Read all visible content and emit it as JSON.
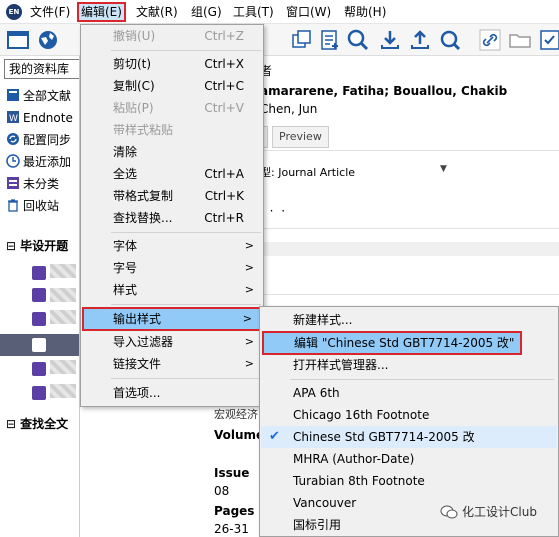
{
  "menubar": {
    "app_logo": "EN",
    "items": [
      "文件(F)",
      "编辑(E)",
      "文献(R)",
      "组(G)",
      "工具(T)",
      "窗口(W)",
      "帮助(H)"
    ]
  },
  "sidebar": {
    "library": "我的资料库",
    "items": [
      "全部文献",
      "Endnote",
      "配置同步",
      "最近添加",
      "未分类",
      "回收站"
    ],
    "group_title": "毕设开题",
    "find_full_text": "查找全文"
  },
  "main": {
    "authors_heading": "者",
    "authors_line1": "amararene, Fatiha; Bouallou, Chakib",
    "authors_line2": "Chen, Jun",
    "tab_preview": "Preview",
    "ref_type_label": "型:",
    "ref_type_value": "Journal Article",
    "ellipsis": "· · ·",
    "fragment": "宏观经济",
    "volume_label": "Volume",
    "issue_label": "Issue",
    "issue_value": "08",
    "pages_label": "Pages",
    "pages_value": "26-31"
  },
  "edit_menu": {
    "items": [
      {
        "label": "撤销(U)",
        "shortcut": "Ctrl+Z",
        "disabled": true
      },
      {
        "label": "剪切(t)",
        "shortcut": "Ctrl+X",
        "disabled": false
      },
      {
        "label": "复制(C)",
        "shortcut": "Ctrl+C",
        "disabled": false
      },
      {
        "label": "粘贴(P)",
        "shortcut": "Ctrl+V",
        "disabled": true
      },
      {
        "label": "带样式粘贴",
        "shortcut": "",
        "disabled": true
      },
      {
        "label": "清除",
        "shortcut": "",
        "disabled": false
      },
      {
        "label": "全选",
        "shortcut": "Ctrl+A",
        "disabled": false
      },
      {
        "label": "带格式复制",
        "shortcut": "Ctrl+K",
        "disabled": false
      },
      {
        "label": "查找替换...",
        "shortcut": "Ctrl+R",
        "disabled": false
      },
      {
        "label": "字体",
        "shortcut": "",
        "disabled": false
      },
      {
        "label": "字号",
        "shortcut": "",
        "disabled": false
      },
      {
        "label": "样式",
        "shortcut": "",
        "disabled": false
      },
      {
        "label": "输出样式",
        "shortcut": "",
        "disabled": false
      },
      {
        "label": "导入过滤器",
        "shortcut": "",
        "disabled": false
      },
      {
        "label": "链接文件",
        "shortcut": "",
        "disabled": false
      },
      {
        "label": "首选项...",
        "shortcut": "",
        "disabled": false
      }
    ]
  },
  "output_styles_menu": {
    "new_style": "新建样式...",
    "edit_style": "编辑 \"Chinese Std GBT7714-2005 改\"",
    "open_manager": "打开样式管理器...",
    "styles": [
      "APA 6th",
      "Chicago 16th Footnote",
      "Chinese Std GBT7714-2005 改",
      "MHRA (Author-Date)",
      "Turabian 8th Footnote",
      "Vancouver",
      "国标引用"
    ],
    "checked_style": "Chinese Std GBT7714-2005 改"
  },
  "watermark": {
    "text": "化工设计Club"
  },
  "colors": {
    "highlight": "#91c9f7",
    "outline_red": "#d9262c",
    "menu_bg": "#f0f0f0",
    "group_icon": "#5b3fa5"
  }
}
